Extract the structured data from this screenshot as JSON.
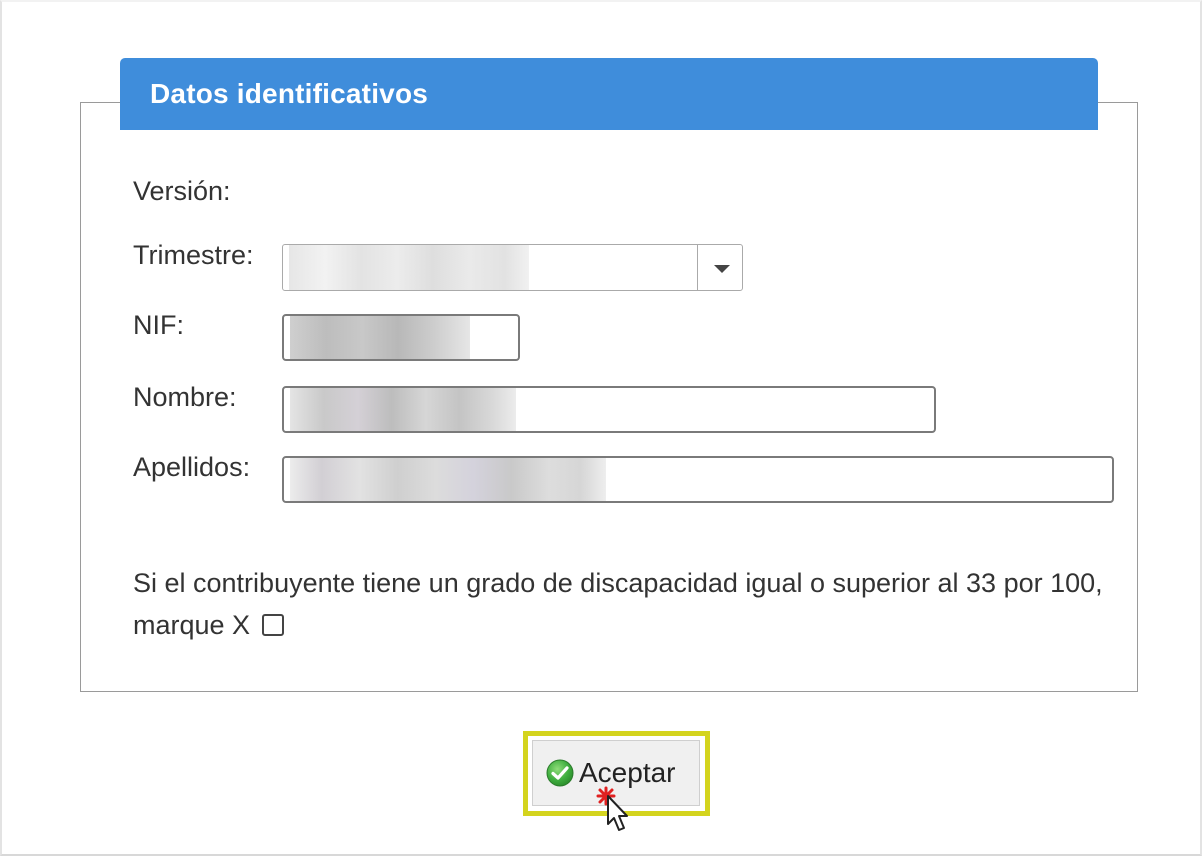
{
  "section": {
    "title": "Datos identificativos"
  },
  "form": {
    "version_label": "Versión:",
    "trimestre_label": "Trimestre:",
    "nif_label": "NIF:",
    "nombre_label": "Nombre:",
    "apellidos_label": "Apellidos:",
    "trimestre_value": "",
    "nif_value": "",
    "nombre_value": "",
    "apellidos_value": ""
  },
  "disability": {
    "text": "Si el contribuyente tiene un grado de discapacidad igual o superior al 33 por 100, marque X",
    "checked": false
  },
  "actions": {
    "accept_label": "Aceptar"
  },
  "icons": {
    "accept": "check-circle-icon",
    "dropdown": "chevron-down-icon",
    "cursor": "mouse-pointer-icon"
  },
  "colors": {
    "header_blue": "#3f8ddb",
    "highlight_yellow": "#d4d41e",
    "accept_green": "#3fae3f",
    "click_marker_red": "#e02020"
  }
}
